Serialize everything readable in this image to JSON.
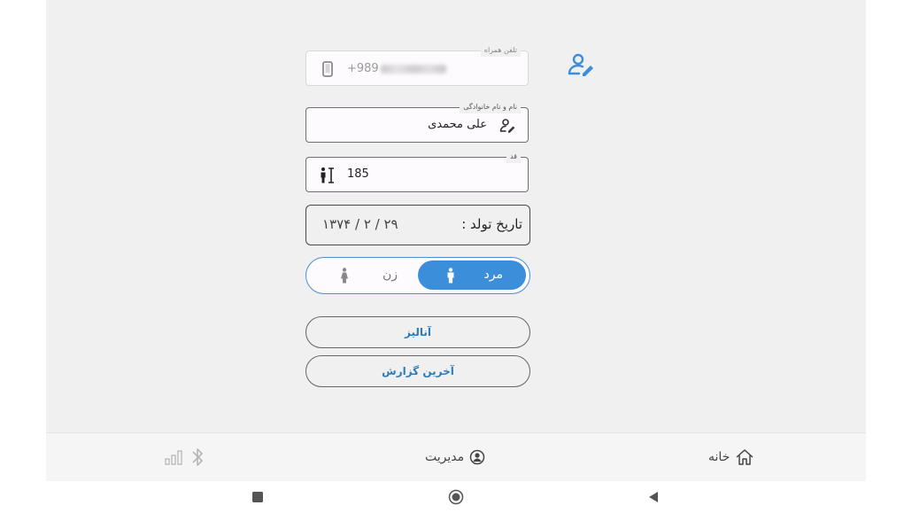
{
  "form": {
    "phone": {
      "legend": "تلفن همراه",
      "value_prefix": "+989"
    },
    "name": {
      "legend": "نام و نام خانوادگی",
      "value": "علی محمدی"
    },
    "height": {
      "legend": "قد",
      "value": "185"
    },
    "birth": {
      "label": "تاریخ تولد :",
      "value": "۱۳۷۴ / ۲ / ۲۹"
    },
    "gender": {
      "male": "مرد",
      "female": "زن",
      "selected": "male"
    },
    "analyze_label": "آنالیز",
    "report_label": "آخرین گزارش"
  },
  "bottom_nav": {
    "home": "خانه",
    "management": "مدیریت"
  },
  "icons": {
    "edit_profile": "user-edit-icon",
    "phone": "mobile-phone-icon",
    "name": "user-edit-icon",
    "height": "height-measure-icon",
    "male": "male-icon",
    "female": "female-icon",
    "home": "home-icon",
    "management": "user-circle-icon",
    "bluetooth": "bluetooth-icon",
    "signal": "signal-bars-icon"
  },
  "colors": {
    "accent": "#3b8ed9",
    "button_text": "#2e7bb8",
    "background": "#f0f0f0"
  }
}
